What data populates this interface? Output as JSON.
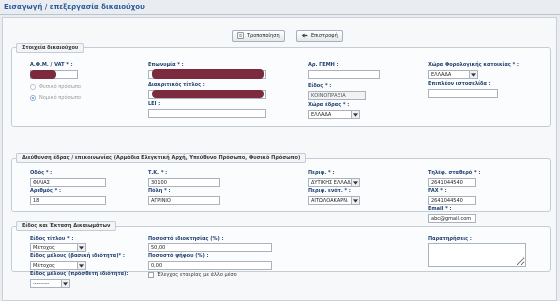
{
  "page": {
    "title": "Εισαγωγή / επεξεργασία δικαιούχου"
  },
  "toolbar": {
    "edit_label": "Τροποποίηση",
    "back_label": "Επιστροφή"
  },
  "section1": {
    "legend": "Στοιχεία δικαιούχου",
    "afm_label": "Α.Φ.Μ. / VAT * :",
    "person_natural": "Φυσικό πρόσωπο",
    "person_legal": "Νομικό πρόσωπο",
    "name_label": "Επωνυμία * :",
    "trade_name_label": "Διακριτικός τίτλος :",
    "li_label": "LEI :",
    "gemi_label": "Αρ. ΓΕΜΗ :",
    "type_label": "Είδος * :",
    "type_value": "ΚΟΙΝΟΠΡΑΞΙΑ",
    "hq_country_label": "Χώρα έδρας * :",
    "hq_country_value": "ΕΛΛΑΔΑ",
    "tax_country_label": "Χώρα Φορολογικής κατοικίας * :",
    "tax_country_value": "ΕΛΛΑΔΑ",
    "extra_activity_label": "Επιπλέον ιστοσελίδα :"
  },
  "section2": {
    "legend": "Διεύθυνση έδρας / επικοινωνίας (Αρμόδια Ελεγκτική Αρχή, Υπεύθυνο Πρόσωπο, Φυσικό Πρόσωπο)",
    "street_label": "Οδός * :",
    "street_value": "ΦΙΛΙΑΣ",
    "number_label": "Αριθμός * :",
    "number_value": "18",
    "tk_label": "Τ.Κ. * :",
    "tk_value": "30100",
    "city_label": "Πόλη * :",
    "city_value": "ΑΓΡΙΝΙΟ",
    "region_label": "Περιφ. * :",
    "region_value": "ΔΥΤΙΚΗΣ ΕΛΛΑΔ",
    "unit_label": "Περιφ. ενότ. * :",
    "unit_value": "ΑΙΤΩΛΟΑΚΑΡΝ.",
    "phone_label": "Τηλέφ. σταθερό * :",
    "phone_value": "2641044540",
    "fax_label": "FAX * :",
    "fax_value": "2641044540",
    "email_label": "Email * :",
    "email_value": "abc@gmail.com"
  },
  "section3": {
    "legend": "Είδος και Έκταση Δικαιωμάτων",
    "right_type_label": "Είδος τίτλου * :",
    "right_type_value": "Μέτοχος",
    "owner_type_label": "Είδος μέλους (βασική ιδιότητα)* :",
    "owner_type_value": "Μέτοχος",
    "member_label": "Είδος μέλους (πρόσθετη ιδιότητα):",
    "member_value": "---------",
    "pct_owner_label": "Ποσοστό ιδιοκτησίας (%) :",
    "pct_owner_value": "50,00",
    "pct_vote_label": "Ποσοστό ψήφου (%) :",
    "pct_vote_value": "0,00",
    "control_label": "Έλεγχος εταιρίας με άλλο μέσο",
    "notes_label": "Παρατηρήσεις :"
  }
}
